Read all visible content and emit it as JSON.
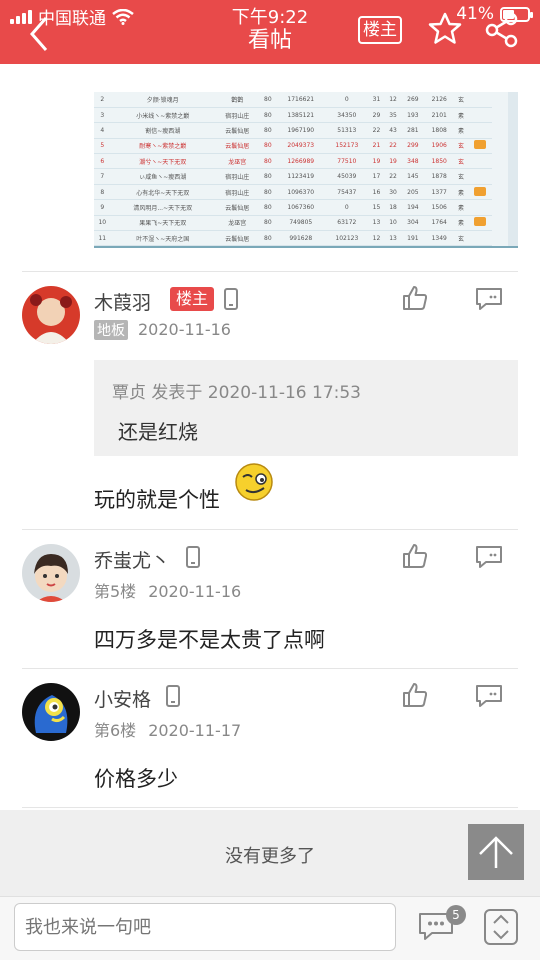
{
  "status_bar": {
    "carrier": "中国联通",
    "time": "下午9:22",
    "battery_text": "41%",
    "battery_level": 0.41
  },
  "nav": {
    "title": "看帖",
    "owner_button": "楼主"
  },
  "screenshot_table": {
    "rows": [
      [
        "2",
        "夕颜·锁魂月",
        "鹳鹳",
        "80",
        "1716621",
        "0",
        "31",
        "12",
        "269",
        "2126",
        "玄"
      ],
      [
        "3",
        "小米线ヽ~紫禁之巅",
        "宿羽山庄",
        "80",
        "1385121",
        "34350",
        "29",
        "35",
        "193",
        "2101",
        "素"
      ],
      [
        "4",
        "割信~瘦西湖",
        "云鬟仙居",
        "80",
        "1967190",
        "51313",
        "22",
        "43",
        "281",
        "1808",
        "素"
      ],
      [
        "5",
        "耐寒ヽ~紫禁之巅",
        "云鬟仙居",
        "80",
        "2049373",
        "152173",
        "21",
        "22",
        "299",
        "1906",
        "玄"
      ],
      [
        "6",
        "潮兮ヽ~天下无双",
        "龙巫宫",
        "80",
        "1266989",
        "77510",
        "19",
        "19",
        "348",
        "1850",
        "玄"
      ],
      [
        "7",
        "ぃ咸鱼ヽ~瘦西湖",
        "宿羽山庄",
        "80",
        "1123419",
        "45039",
        "17",
        "22",
        "145",
        "1878",
        "玄"
      ],
      [
        "8",
        "心有北华~天下无双",
        "宿羽山庄",
        "80",
        "1096370",
        "75437",
        "16",
        "30",
        "205",
        "1377",
        "素"
      ],
      [
        "9",
        "清风明月...~天下无双",
        "云鬟仙居",
        "80",
        "1067360",
        "0",
        "15",
        "18",
        "194",
        "1506",
        "素"
      ],
      [
        "10",
        "果果飞~天下无双",
        "龙巫宫",
        "80",
        "749805",
        "63172",
        "13",
        "10",
        "304",
        "1764",
        "素"
      ],
      [
        "11",
        "叶不湿ヽ~天府之国",
        "云鬟仙居",
        "80",
        "991628",
        "102123",
        "12",
        "13",
        "191",
        "1349",
        "玄"
      ]
    ]
  },
  "posts": [
    {
      "username": "木葭羽",
      "owner_tag": "楼主",
      "floor": "地板",
      "date": "2020-11-16",
      "quote_meta": "覃贞 发表于 2020-11-16 17:53",
      "quote_text": "还是红烧",
      "content": "玩的就是个性"
    },
    {
      "username": "乔蚩尤丶",
      "floor": "第5楼",
      "date": "2020-11-16",
      "content": "四万多是不是太贵了点啊"
    },
    {
      "username": "小安格",
      "floor": "第6楼",
      "date": "2020-11-17",
      "content": "价格多少"
    }
  ],
  "footer": {
    "no_more": "没有更多了",
    "input_placeholder": "我也来说一句吧",
    "comment_count": "5"
  },
  "colors": {
    "brand_red": "#e84a4a"
  }
}
